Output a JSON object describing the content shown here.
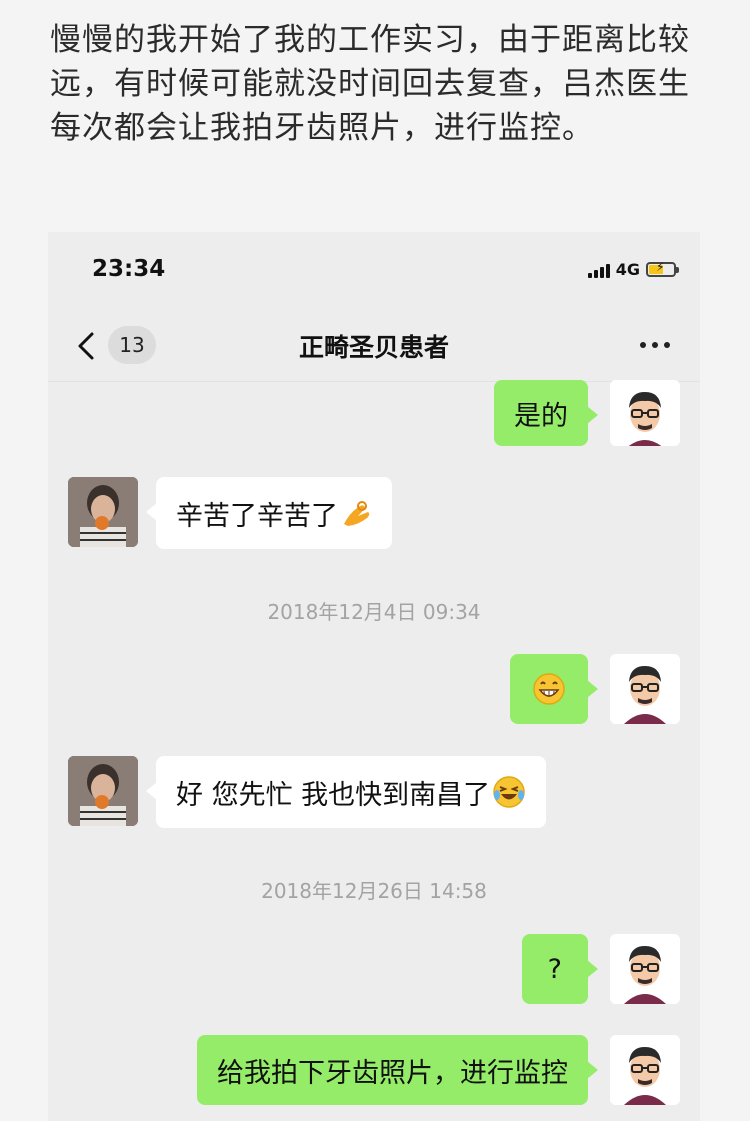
{
  "intro_text": "慢慢的我开始了我的工作实习，由于距离比较远，有时候可能就没时间回去复查，吕杰医生每次都会让我拍牙齿照片，进行监控。",
  "status_bar": {
    "time": "23:34",
    "network": "4G"
  },
  "nav": {
    "unread_count": "13",
    "title": "正畸圣贝患者"
  },
  "messages": {
    "m1": "是的",
    "m2": "辛苦了辛苦了",
    "ts1": "2018年12月4日 09:34",
    "ts2": "2018年12月26日 14:58",
    "m4": "好 您先忙 我也快到南昌了",
    "m5": "?",
    "m6": "给我拍下牙齿照片，进行监控"
  },
  "colors": {
    "outgoing_bubble": "#95ec69",
    "incoming_bubble": "#ffffff",
    "chat_bg": "#ededed"
  }
}
